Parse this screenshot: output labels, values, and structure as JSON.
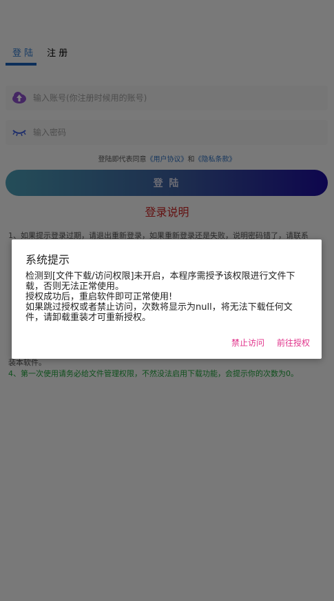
{
  "tabs": [
    {
      "label": "登 陆"
    },
    {
      "label": "注 册"
    }
  ],
  "account_field": {
    "placeholder": "输入账号(你注册时候用的账号)",
    "icon": "cloud-upload-icon"
  },
  "password_field": {
    "placeholder": "输入密码",
    "icon": "eye-closed-icon"
  },
  "agreement": {
    "prefix": "登陆即代表同意",
    "user_agreement": "《用户协议》",
    "and": "和",
    "privacy": "《隐私条款》"
  },
  "login_button": {
    "label": "登 陆"
  },
  "explain": {
    "title": "登录说明",
    "line1": "1、如果提示登录过期，请退出重新登录，如果重新登录还是失败，说明密码错了，请联系",
    "line_tail": "装本软件。",
    "line4": "4、第一次使用请务必给文件管理权限，不然没法启用下载功能，会提示你的次数为0。"
  },
  "dialog": {
    "title": "系统提示",
    "lines": [
      "检测到[文件下载/访问权限]未开启，本程序需授予该权限进行文件下",
      "载，否则无法正常使用。",
      "授权成功后，重启软件即可正常使用!",
      "如果跳过授权或者禁止访问，次数将显示为null，将无法下载任何文",
      "件，请卸载重装才可重新授权。"
    ],
    "deny_label": "禁止访问",
    "grant_label": "前往授权"
  },
  "colors": {
    "accent": "#1b5fb5",
    "dialog_button": "#e0328a",
    "explain_title": "#c62222",
    "note_green": "#1fa03a"
  }
}
